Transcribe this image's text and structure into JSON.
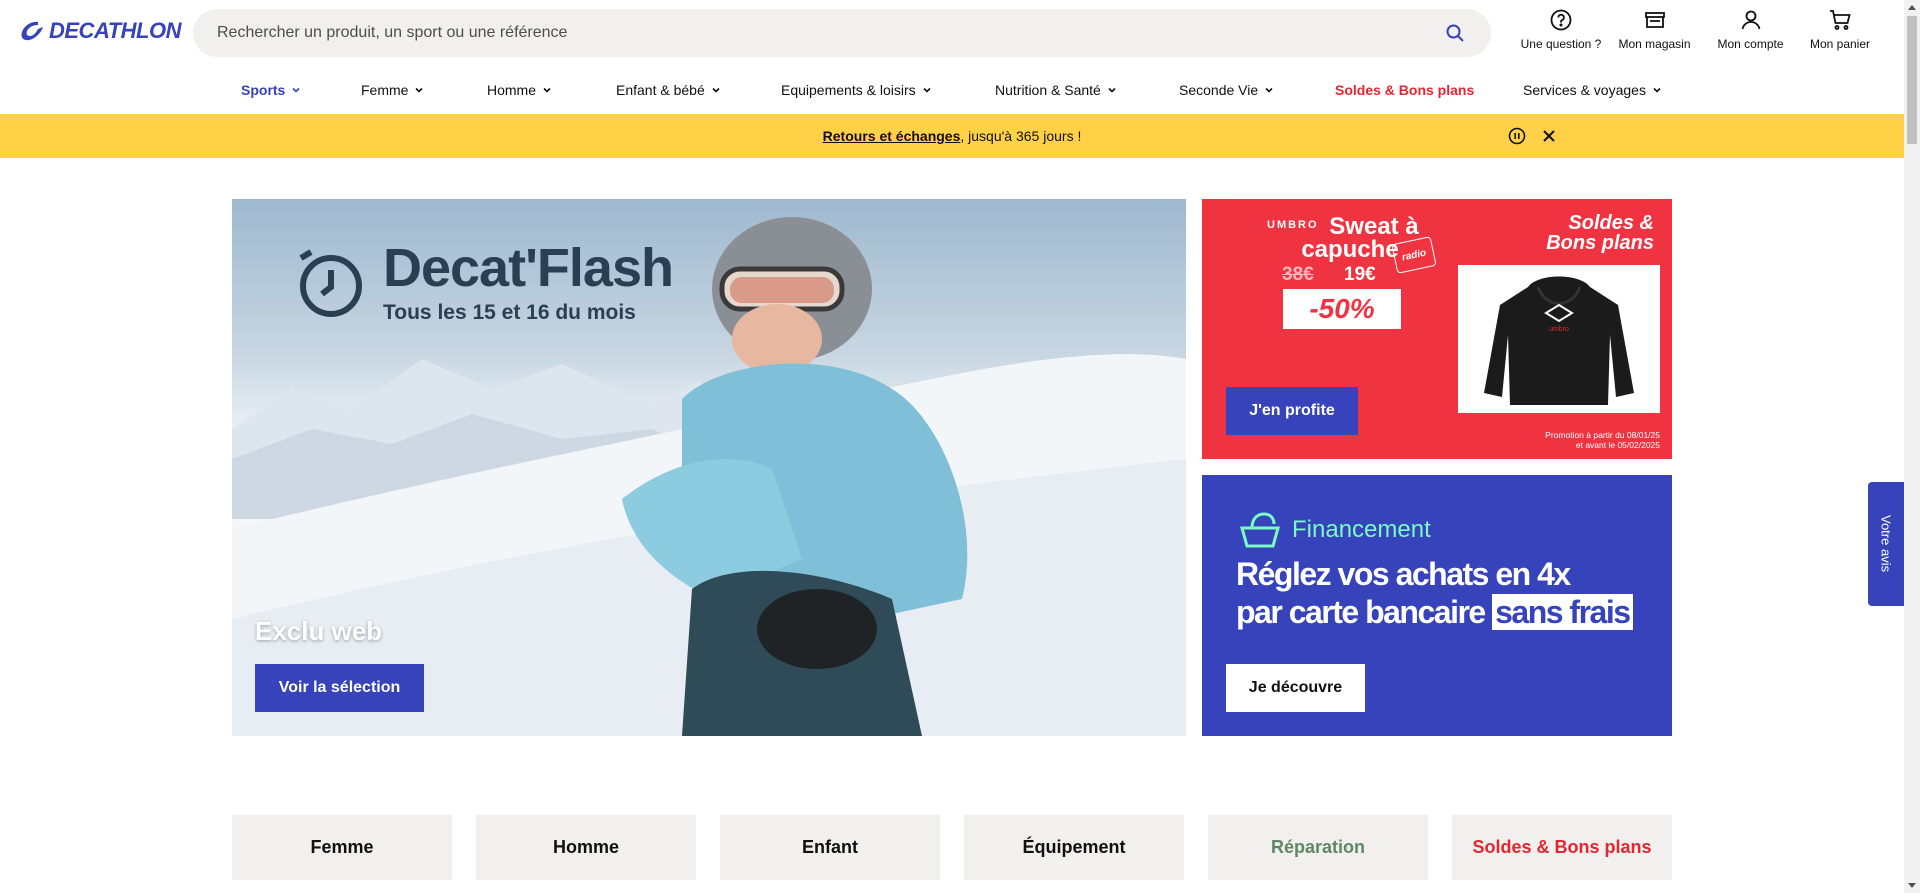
{
  "brand": {
    "logo_text": "DECATHLON",
    "accent_color": "#3643ba",
    "sale_color": "#e3262f"
  },
  "search": {
    "placeholder": "Rechercher un produit, un sport ou une référence",
    "value": ""
  },
  "tools": [
    {
      "label": "Une question ?",
      "icon": "question-icon"
    },
    {
      "label": "Mon magasin",
      "icon": "store-icon"
    },
    {
      "label": "Mon compte",
      "icon": "user-icon"
    },
    {
      "label": "Mon panier",
      "icon": "cart-icon"
    }
  ],
  "nav": [
    {
      "label": "Sports",
      "has_menu": true
    },
    {
      "label": "Femme",
      "has_menu": true
    },
    {
      "label": "Homme",
      "has_menu": true
    },
    {
      "label": "Enfant & bébé",
      "has_menu": true
    },
    {
      "label": "Equipements & loisirs",
      "has_menu": true
    },
    {
      "label": "Nutrition & Santé",
      "has_menu": true
    },
    {
      "label": "Seconde Vie",
      "has_menu": true
    },
    {
      "label": "Soldes & Bons plans",
      "has_menu": false
    },
    {
      "label": "Services & voyages",
      "has_menu": true
    }
  ],
  "banner": {
    "link": "Retours et échanges",
    "text": ", jusqu'à 365 jours !",
    "color": "#ffd147"
  },
  "hero": {
    "title": "Decat'Flash",
    "subtitle": "Tous les 15 et 16 du mois",
    "tag": "Exclu web",
    "cta": "Voir la sélection"
  },
  "promo": {
    "brand": "UMBRO",
    "title": "Sweat à capuche",
    "old_price": "38€",
    "new_price": "19€",
    "discount": "-50%",
    "radio_badge": "radio",
    "sale_tag_line1": "Soldes &",
    "sale_tag_line2": "Bons plans",
    "cta": "J'en profite",
    "legal_line1": "Promotion à partir du 08/01/25",
    "legal_line2": "et avant le 05/02/2025",
    "color": "#ef3341"
  },
  "finance": {
    "label": "Financement",
    "line1": "Réglez vos achats en 4x",
    "line2_prefix": "par carte bancaire",
    "line2_highlight": "sans frais",
    "cta": "Je découvre"
  },
  "categories": [
    "Femme",
    "Homme",
    "Enfant",
    "Équipement",
    "Réparation",
    "Soldes & Bons plans"
  ],
  "feedback": {
    "label": "Votre avis"
  }
}
